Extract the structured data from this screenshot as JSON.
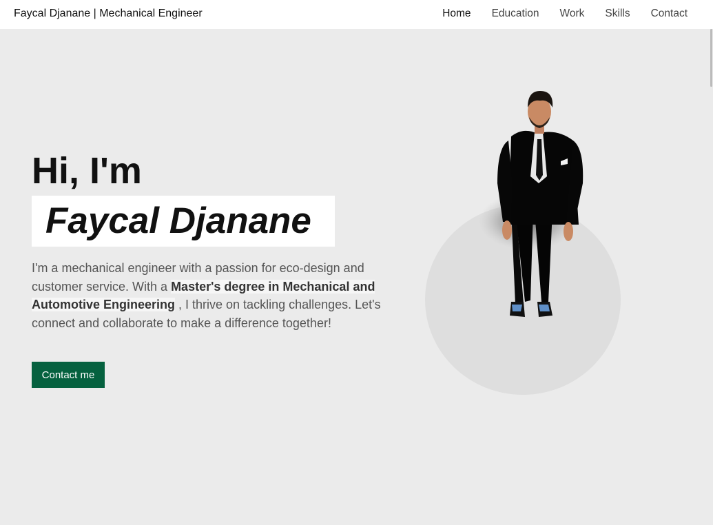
{
  "nav": {
    "brand": "Faycal Djanane | Mechanical Engineer",
    "links": [
      {
        "label": "Home"
      },
      {
        "label": "Education"
      },
      {
        "label": "Work"
      },
      {
        "label": "Skills"
      },
      {
        "label": "Contact"
      }
    ]
  },
  "hero": {
    "greeting": "Hi, I'm",
    "name": "Faycal Djanane",
    "intro_before": "I'm a mechanical engineer with a passion for eco-design and customer service. With a ",
    "intro_highlight": "Master's degree in Mechanical and Automotive Engineering",
    "intro_after": " , I thrive on tackling challenges. Let's connect and collaborate to make a difference together!",
    "cta_label": "Contact me"
  },
  "colors": {
    "background": "#ebebeb",
    "navbar": "#ffffff",
    "cta": "#05613f"
  },
  "icons": {
    "avatar": "3d-avatar-man-in-suit"
  }
}
